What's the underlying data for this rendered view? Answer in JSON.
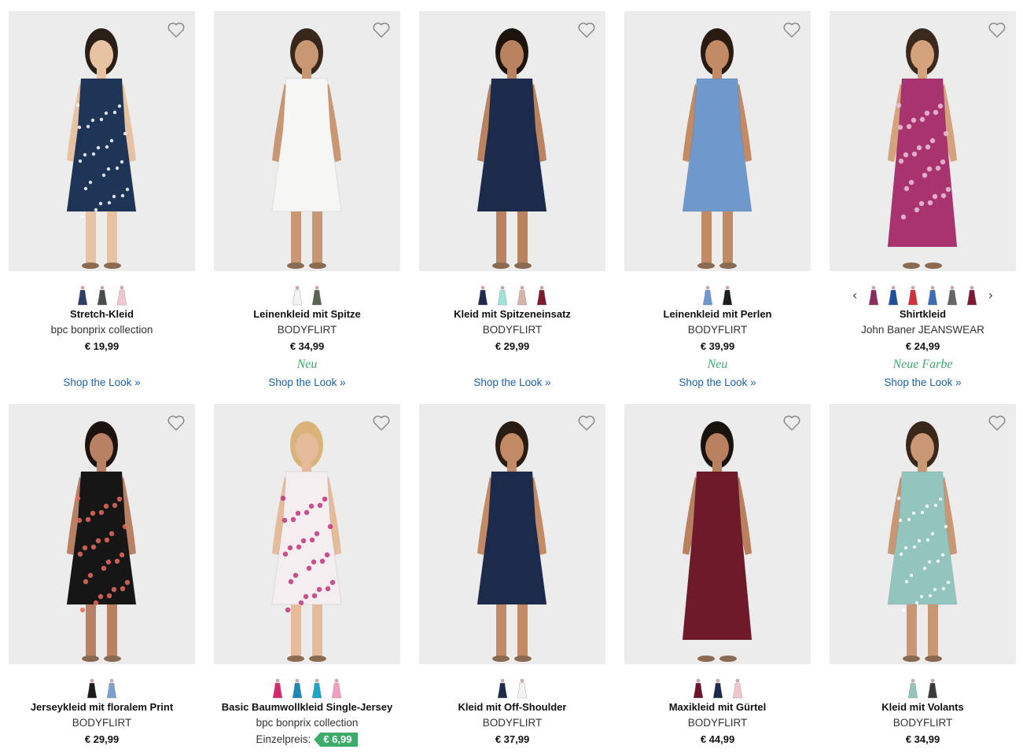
{
  "products": [
    {
      "name": "Stretch-Kleid",
      "brand": "bpc bonprix collection",
      "price": "€ 19,99",
      "badge": "",
      "link": "Shop the Look »",
      "swatches": [
        "#2c3e63",
        "#4a4f4c",
        "#f2c6cf"
      ],
      "dress": "#1f3557",
      "pattern": "#ffffff",
      "skin": "#e7c3a4",
      "hair": "#2b1e17"
    },
    {
      "name": "Leinenkleid mit Spitze",
      "brand": "BODYFLIRT",
      "price": "€ 34,99",
      "badge": "Neu",
      "link": "Shop the Look »",
      "swatches": [
        "#f4f4f4",
        "#5d6352"
      ],
      "dress": "#f6f6f4",
      "pattern": "",
      "skin": "#c99774",
      "hair": "#3a271c"
    },
    {
      "name": "Kleid mit Spitzeneinsatz",
      "brand": "BODYFLIRT",
      "price": "€ 29,99",
      "badge": "",
      "link": "Shop the Look »",
      "swatches": [
        "#1d2a4c",
        "#9fe2d9",
        "#d7b4ab",
        "#7b1b2c"
      ],
      "dress": "#1c2a4b",
      "pattern": "",
      "skin": "#b9835f",
      "hair": "#1d140e"
    },
    {
      "name": "Leinenkleid mit Perlen",
      "brand": "BODYFLIRT",
      "price": "€ 39,99",
      "badge": "Neu",
      "link": "Shop the Look »",
      "swatches": [
        "#6e97cf",
        "#1d1d1d"
      ],
      "dress": "#6f98cc",
      "pattern": "",
      "skin": "#c28b66",
      "hair": "#2a1b12"
    },
    {
      "name": "Shirtkleid",
      "brand": "John Baner JEANSWEAR",
      "price": "€ 24,99",
      "badge": "Neue Farbe",
      "link": "Shop the Look »",
      "swatches": [
        "#8e2b5e",
        "#1f4f9a",
        "#d1303d",
        "#3f6db3",
        "#666666",
        "#7a1b35"
      ],
      "dress": "#a8336f",
      "pattern": "#e9c6db",
      "skin": "#d4a27c",
      "hair": "#3b291d"
    },
    {
      "name": "Jerseykleid mit floralem Print",
      "brand": "BODYFLIRT",
      "price": "€ 29,99",
      "badge": "",
      "link": "",
      "swatches": [
        "#1a1a1a",
        "#7da0cf"
      ],
      "dress": "#161616",
      "pattern": "#e96c5a",
      "skin": "#b98163",
      "hair": "#1c130e"
    },
    {
      "name": "Basic Baumwollkleid Single-Jersey",
      "brand": "bpc bonprix collection",
      "price": "",
      "badge": "",
      "link": "",
      "sale_label": "Einzelpreis:",
      "sale_price": "€ 6,99",
      "swatches": [
        "#d8296f",
        "#1f87b3",
        "#1ea4c8",
        "#f59cc4"
      ],
      "dress": "#f4eef0",
      "pattern": "#c2307c",
      "skin": "#e5bb9b",
      "hair": "#d9b37a"
    },
    {
      "name": "Kleid mit Off-Shoulder",
      "brand": "BODYFLIRT",
      "price": "€ 37,99",
      "badge": "",
      "link": "",
      "swatches": [
        "#1d2a4c",
        "#f4f4f4"
      ],
      "dress": "#1c2a4b",
      "pattern": "",
      "skin": "#c28b66",
      "hair": "#2b1c13"
    },
    {
      "name": "Maxikleid mit Gürtel",
      "brand": "BODYFLIRT",
      "price": "€ 44,99",
      "badge": "",
      "link": "",
      "swatches": [
        "#6f1428",
        "#1d2a4c",
        "#f2c6cf"
      ],
      "dress": "#6e1a2b",
      "pattern": "",
      "skin": "#b8805f",
      "hair": "#1a120d"
    },
    {
      "name": "Kleid mit Volants",
      "brand": "BODYFLIRT",
      "price": "€ 34,99",
      "badge": "",
      "link": "",
      "swatches": [
        "#93c4be",
        "#3a3a3a"
      ],
      "dress": "#93c4be",
      "pattern": "#ffffff",
      "skin": "#c99774",
      "hair": "#3a271c"
    }
  ],
  "colors": {
    "accent_link": "#1b62a8",
    "accent_new": "#3ba86a",
    "sale_tag": "#3dab6a"
  },
  "icons": {
    "wishlist": "heart-outline-icon",
    "prev": "chevron-left-icon",
    "next": "chevron-right-icon"
  }
}
